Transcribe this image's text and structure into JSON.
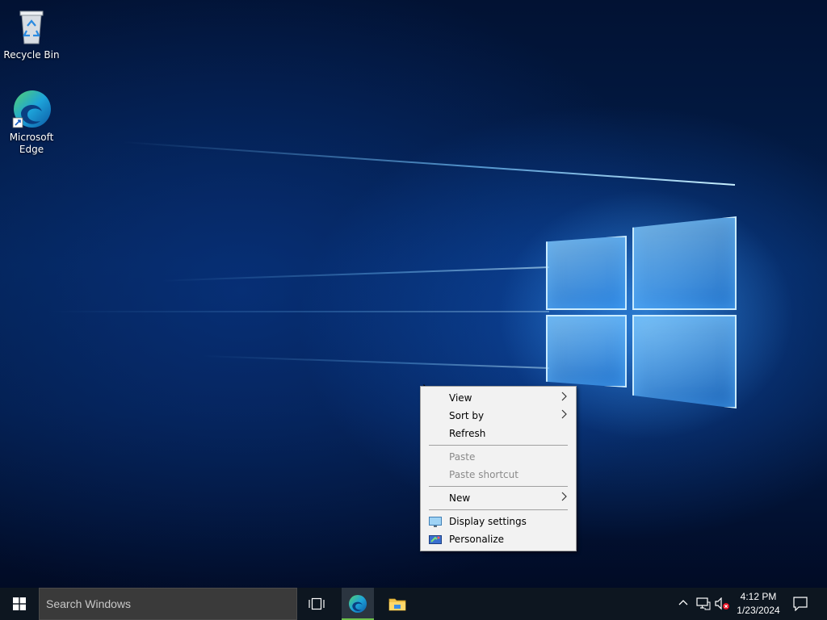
{
  "desktop": {
    "icons": [
      {
        "label": "Recycle Bin",
        "icon": "recycle-bin-icon"
      },
      {
        "label": "Microsoft\nEdge",
        "label_line1": "Microsoft",
        "label_line2": "Edge",
        "icon": "edge-icon"
      }
    ]
  },
  "context_menu": {
    "items": [
      {
        "label": "View",
        "submenu": true,
        "enabled": true
      },
      {
        "label": "Sort by",
        "submenu": true,
        "enabled": true
      },
      {
        "label": "Refresh",
        "submenu": false,
        "enabled": true
      },
      {
        "label": "Paste",
        "submenu": false,
        "enabled": false
      },
      {
        "label": "Paste shortcut",
        "submenu": false,
        "enabled": false
      },
      {
        "label": "New",
        "submenu": true,
        "enabled": true
      },
      {
        "label": "Display settings",
        "submenu": false,
        "enabled": true,
        "icon": "display-settings-icon"
      },
      {
        "label": "Personalize",
        "submenu": false,
        "enabled": true,
        "icon": "personalize-icon"
      }
    ],
    "submenu_arrow": ">"
  },
  "taskbar": {
    "search_placeholder": "Search Windows",
    "pinned": [
      "task-view-icon",
      "edge-icon",
      "file-explorer-icon"
    ],
    "tray": {
      "chevron": "^",
      "time": "4:12 PM",
      "date": "1/23/2024"
    }
  },
  "colors": {
    "accent_green": "#6cc04a",
    "menu_bg": "#f2f2f2",
    "taskbar_bg": "#0d1620"
  }
}
